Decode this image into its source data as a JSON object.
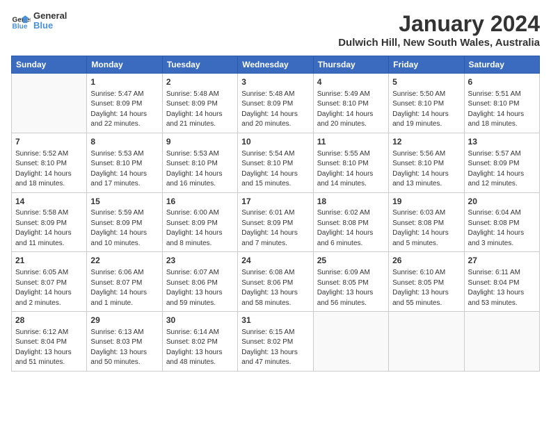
{
  "logo": {
    "line1": "General",
    "line2": "Blue"
  },
  "title": "January 2024",
  "subtitle": "Dulwich Hill, New South Wales, Australia",
  "days_of_week": [
    "Sunday",
    "Monday",
    "Tuesday",
    "Wednesday",
    "Thursday",
    "Friday",
    "Saturday"
  ],
  "weeks": [
    [
      {
        "day": "",
        "info": ""
      },
      {
        "day": "1",
        "info": "Sunrise: 5:47 AM\nSunset: 8:09 PM\nDaylight: 14 hours\nand 22 minutes."
      },
      {
        "day": "2",
        "info": "Sunrise: 5:48 AM\nSunset: 8:09 PM\nDaylight: 14 hours\nand 21 minutes."
      },
      {
        "day": "3",
        "info": "Sunrise: 5:48 AM\nSunset: 8:09 PM\nDaylight: 14 hours\nand 20 minutes."
      },
      {
        "day": "4",
        "info": "Sunrise: 5:49 AM\nSunset: 8:10 PM\nDaylight: 14 hours\nand 20 minutes."
      },
      {
        "day": "5",
        "info": "Sunrise: 5:50 AM\nSunset: 8:10 PM\nDaylight: 14 hours\nand 19 minutes."
      },
      {
        "day": "6",
        "info": "Sunrise: 5:51 AM\nSunset: 8:10 PM\nDaylight: 14 hours\nand 18 minutes."
      }
    ],
    [
      {
        "day": "7",
        "info": "Sunrise: 5:52 AM\nSunset: 8:10 PM\nDaylight: 14 hours\nand 18 minutes."
      },
      {
        "day": "8",
        "info": "Sunrise: 5:53 AM\nSunset: 8:10 PM\nDaylight: 14 hours\nand 17 minutes."
      },
      {
        "day": "9",
        "info": "Sunrise: 5:53 AM\nSunset: 8:10 PM\nDaylight: 14 hours\nand 16 minutes."
      },
      {
        "day": "10",
        "info": "Sunrise: 5:54 AM\nSunset: 8:10 PM\nDaylight: 14 hours\nand 15 minutes."
      },
      {
        "day": "11",
        "info": "Sunrise: 5:55 AM\nSunset: 8:10 PM\nDaylight: 14 hours\nand 14 minutes."
      },
      {
        "day": "12",
        "info": "Sunrise: 5:56 AM\nSunset: 8:10 PM\nDaylight: 14 hours\nand 13 minutes."
      },
      {
        "day": "13",
        "info": "Sunrise: 5:57 AM\nSunset: 8:09 PM\nDaylight: 14 hours\nand 12 minutes."
      }
    ],
    [
      {
        "day": "14",
        "info": "Sunrise: 5:58 AM\nSunset: 8:09 PM\nDaylight: 14 hours\nand 11 minutes."
      },
      {
        "day": "15",
        "info": "Sunrise: 5:59 AM\nSunset: 8:09 PM\nDaylight: 14 hours\nand 10 minutes."
      },
      {
        "day": "16",
        "info": "Sunrise: 6:00 AM\nSunset: 8:09 PM\nDaylight: 14 hours\nand 8 minutes."
      },
      {
        "day": "17",
        "info": "Sunrise: 6:01 AM\nSunset: 8:09 PM\nDaylight: 14 hours\nand 7 minutes."
      },
      {
        "day": "18",
        "info": "Sunrise: 6:02 AM\nSunset: 8:08 PM\nDaylight: 14 hours\nand 6 minutes."
      },
      {
        "day": "19",
        "info": "Sunrise: 6:03 AM\nSunset: 8:08 PM\nDaylight: 14 hours\nand 5 minutes."
      },
      {
        "day": "20",
        "info": "Sunrise: 6:04 AM\nSunset: 8:08 PM\nDaylight: 14 hours\nand 3 minutes."
      }
    ],
    [
      {
        "day": "21",
        "info": "Sunrise: 6:05 AM\nSunset: 8:07 PM\nDaylight: 14 hours\nand 2 minutes."
      },
      {
        "day": "22",
        "info": "Sunrise: 6:06 AM\nSunset: 8:07 PM\nDaylight: 14 hours\nand 1 minute."
      },
      {
        "day": "23",
        "info": "Sunrise: 6:07 AM\nSunset: 8:06 PM\nDaylight: 13 hours\nand 59 minutes."
      },
      {
        "day": "24",
        "info": "Sunrise: 6:08 AM\nSunset: 8:06 PM\nDaylight: 13 hours\nand 58 minutes."
      },
      {
        "day": "25",
        "info": "Sunrise: 6:09 AM\nSunset: 8:05 PM\nDaylight: 13 hours\nand 56 minutes."
      },
      {
        "day": "26",
        "info": "Sunrise: 6:10 AM\nSunset: 8:05 PM\nDaylight: 13 hours\nand 55 minutes."
      },
      {
        "day": "27",
        "info": "Sunrise: 6:11 AM\nSunset: 8:04 PM\nDaylight: 13 hours\nand 53 minutes."
      }
    ],
    [
      {
        "day": "28",
        "info": "Sunrise: 6:12 AM\nSunset: 8:04 PM\nDaylight: 13 hours\nand 51 minutes."
      },
      {
        "day": "29",
        "info": "Sunrise: 6:13 AM\nSunset: 8:03 PM\nDaylight: 13 hours\nand 50 minutes."
      },
      {
        "day": "30",
        "info": "Sunrise: 6:14 AM\nSunset: 8:02 PM\nDaylight: 13 hours\nand 48 minutes."
      },
      {
        "day": "31",
        "info": "Sunrise: 6:15 AM\nSunset: 8:02 PM\nDaylight: 13 hours\nand 47 minutes."
      },
      {
        "day": "",
        "info": ""
      },
      {
        "day": "",
        "info": ""
      },
      {
        "day": "",
        "info": ""
      }
    ]
  ]
}
